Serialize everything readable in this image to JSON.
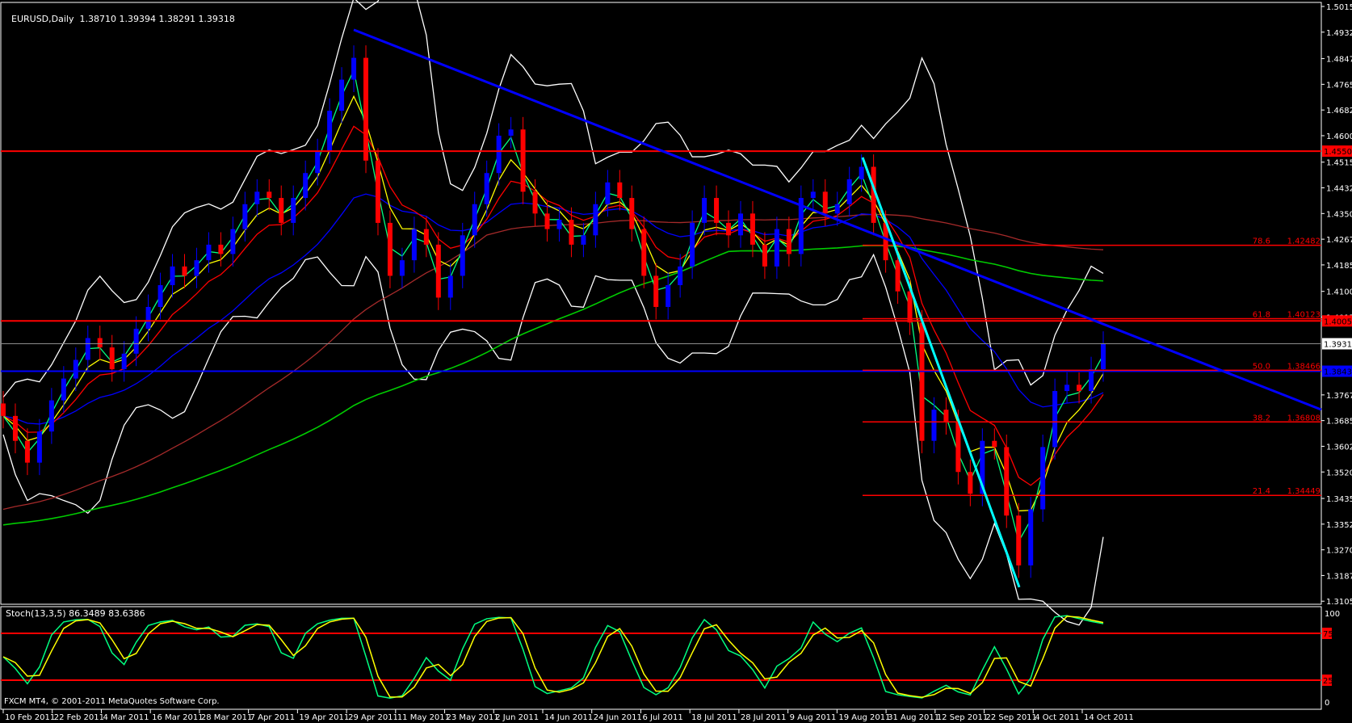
{
  "header": {
    "symbol_timeframe": "EURUSD,Daily",
    "ohlc": "1.38710 1.39394 1.38291 1.39318"
  },
  "stoch_header": "Stoch(13,3,5) 86.3489 83.6386",
  "copyright": "FXCM MT4, © 2001-2011 MetaQuotes Software Corp.",
  "colors": {
    "background": "#000000",
    "bull": "#0000ff",
    "bear": "#ff0000",
    "axis": "#ffffff",
    "level": "#ff0000",
    "trend": "#0000ff",
    "trend2": "#00ffff",
    "ma_fast": "#00ff80",
    "ma_mid": "#ffff00",
    "ma_slow": "#ff0000",
    "ma_long": "#0000ff",
    "ma_xlong": "#a52a2a",
    "ma_200": "#00cc00",
    "bands": "#ffffff"
  },
  "chart_data": {
    "type": "candlestick",
    "symbol": "EURUSD",
    "timeframe": "Daily",
    "ylim": [
      1.3105,
      1.5015
    ],
    "price_ticks": [
      "1.50150",
      "1.49325",
      "1.48475",
      "1.47650",
      "1.46825",
      "1.46000",
      "1.45150",
      "1.44325",
      "1.43500",
      "1.42675",
      "1.41850",
      "1.41000",
      "1.40175",
      "1.37675",
      "1.36850",
      "1.36025",
      "1.35200",
      "1.34350",
      "1.33525",
      "1.32700",
      "1.31875",
      "1.31050"
    ],
    "date_ticks": [
      "10 Feb 2011",
      "22 Feb 2011",
      "4 Mar 2011",
      "16 Mar 2011",
      "28 Mar 2011",
      "7 Apr 2011",
      "19 Apr 2011",
      "29 Apr 2011",
      "11 May 2011",
      "23 May 2011",
      "2 Jun 2011",
      "14 Jun 2011",
      "24 Jun 2011",
      "6 Jul 2011",
      "18 Jul 2011",
      "28 Jul 2011",
      "9 Aug 2011",
      "19 Aug 2011",
      "31 Aug 2011",
      "12 Sep 2011",
      "22 Sep 2011",
      "4 Oct 2011",
      "14 Oct 2011"
    ],
    "closes": [
      1.37,
      1.362,
      1.355,
      1.365,
      1.375,
      1.382,
      1.388,
      1.395,
      1.392,
      1.385,
      1.39,
      1.398,
      1.405,
      1.412,
      1.418,
      1.415,
      1.42,
      1.425,
      1.422,
      1.43,
      1.438,
      1.442,
      1.44,
      1.432,
      1.44,
      1.448,
      1.455,
      1.468,
      1.478,
      1.485,
      1.452,
      1.432,
      1.415,
      1.42,
      1.43,
      1.425,
      1.408,
      1.415,
      1.428,
      1.438,
      1.448,
      1.46,
      1.462,
      1.442,
      1.435,
      1.43,
      1.433,
      1.425,
      1.428,
      1.438,
      1.445,
      1.44,
      1.43,
      1.415,
      1.405,
      1.412,
      1.418,
      1.432,
      1.44,
      1.432,
      1.428,
      1.435,
      1.425,
      1.418,
      1.43,
      1.422,
      1.44,
      1.442,
      1.435,
      1.438,
      1.446,
      1.45,
      1.432,
      1.42,
      1.41,
      1.4,
      1.362,
      1.372,
      1.368,
      1.352,
      1.345,
      1.362,
      1.36,
      1.338,
      1.322,
      1.34,
      1.36,
      1.378,
      1.38,
      1.378,
      1.385,
      1.39318
    ],
    "current_price": {
      "value": 1.39318,
      "label": "1.39318"
    },
    "horizontal_lines": [
      {
        "value": 1.45504,
        "label": "1.45504",
        "color": "#ff0000"
      },
      {
        "value": 1.40051,
        "label": "1.40051",
        "color": "#ff0000"
      },
      {
        "value": 1.38436,
        "label": "1.38436",
        "color": "#0000ff"
      }
    ],
    "fib_levels": [
      {
        "ratio": "78.6",
        "value": 1.42482,
        "label": "1.42482"
      },
      {
        "ratio": "61.8",
        "value": 1.40123,
        "label": "1.40123"
      },
      {
        "ratio": "50.0",
        "value": 1.38466,
        "label": "1.38466"
      },
      {
        "ratio": "38.2",
        "value": 1.36808,
        "label": "1.36808"
      },
      {
        "ratio": "21.4",
        "value": 1.34449,
        "label": "1.34449"
      }
    ],
    "trendlines": [
      {
        "from": {
          "date": "29 Apr 2011",
          "price": 1.494
        },
        "to": {
          "date": "end",
          "price": 1.372
        },
        "color": "#0000ff"
      },
      {
        "from": {
          "date": "26 Aug 2011",
          "price": 1.453
        },
        "to": {
          "date": "4 Oct 2011",
          "price": 1.315
        },
        "color": "#00ffff"
      }
    ],
    "stochastic": {
      "params": "13,3,5",
      "main": 86.3489,
      "signal": 83.6386,
      "levels": [
        "75",
        "25"
      ],
      "scale": [
        "100",
        "0"
      ]
    }
  }
}
